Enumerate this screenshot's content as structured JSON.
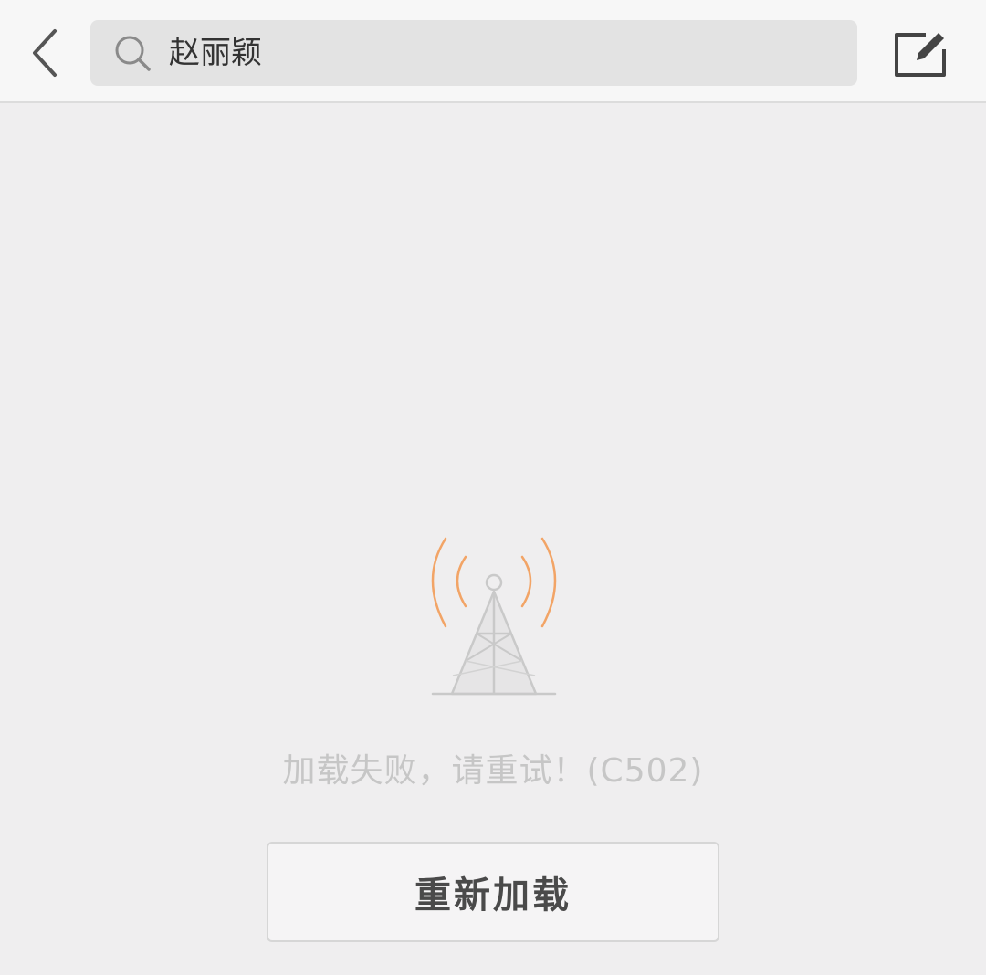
{
  "header": {
    "back_icon": "chevron-left-icon",
    "search": {
      "icon": "search-icon",
      "query": "赵丽颖"
    },
    "compose_icon": "compose-icon"
  },
  "error": {
    "illustration_icon": "signal-tower-icon",
    "message": "加载失败，请重试！(C502)",
    "reload_label": "重新加载"
  },
  "colors": {
    "background": "#efeeef",
    "topbar": "#f7f7f7",
    "search_bg": "#e3e3e3",
    "signal_accent": "#f2a466",
    "error_text": "#c6c6c6"
  }
}
